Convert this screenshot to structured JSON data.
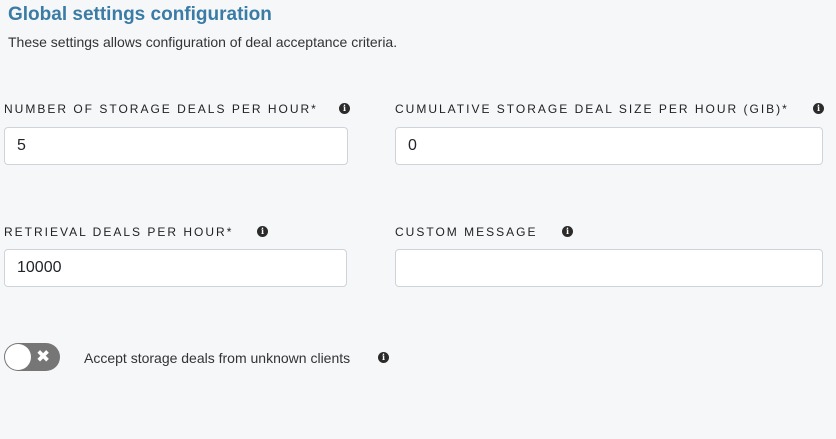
{
  "header": {
    "title": "Global settings configuration",
    "subtitle": "These settings allows configuration of deal acceptance criteria."
  },
  "fields": {
    "storage_deals_per_hour": {
      "label": "NUMBER OF STORAGE DEALS PER HOUR*",
      "value": "5",
      "info_icon": "info-icon"
    },
    "cumulative_storage_size": {
      "label": "CUMULATIVE STORAGE DEAL SIZE PER HOUR (GIB)*",
      "value": "0",
      "info_icon": "info-icon"
    },
    "retrieval_deals_per_hour": {
      "label": "RETRIEVAL DEALS PER HOUR*",
      "value": "10000",
      "info_icon": "info-icon"
    },
    "custom_message": {
      "label": "CUSTOM MESSAGE",
      "value": "",
      "info_icon": "info-icon"
    }
  },
  "unknown_clients_toggle": {
    "label": "Accept storage deals from unknown clients",
    "state": "off",
    "off_glyph": "✖"
  },
  "colors": {
    "title": "#3a7ca5",
    "toggle_off": "#767676",
    "background": "#f6f7f9"
  }
}
